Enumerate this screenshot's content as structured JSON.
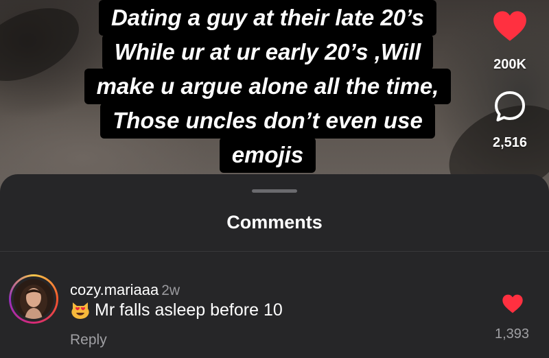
{
  "caption": {
    "lines": [
      "Dating a guy at their late 20’s",
      "While ur at ur early 20’s ,Will",
      "make u argue alone  all the time,",
      "Those uncles don’t even use",
      "emojis"
    ]
  },
  "side_actions": {
    "like_icon": "heart-icon",
    "like_count": "200K",
    "comment_icon": "comment-bubble-icon",
    "comment_count": "2,516"
  },
  "comments_sheet": {
    "title": "Comments",
    "comments": [
      {
        "username": "cozy.mariaaa",
        "time": "2w",
        "emoji": "heart-eyes-cat-emoji",
        "text": "Mr falls asleep before 10",
        "reply_label": "Reply",
        "like_icon": "heart-icon",
        "like_count": "1,393"
      }
    ]
  },
  "colors": {
    "heart": "#ff3040",
    "sheet_bg": "#262628",
    "secondary_text": "#a0a0a4"
  }
}
